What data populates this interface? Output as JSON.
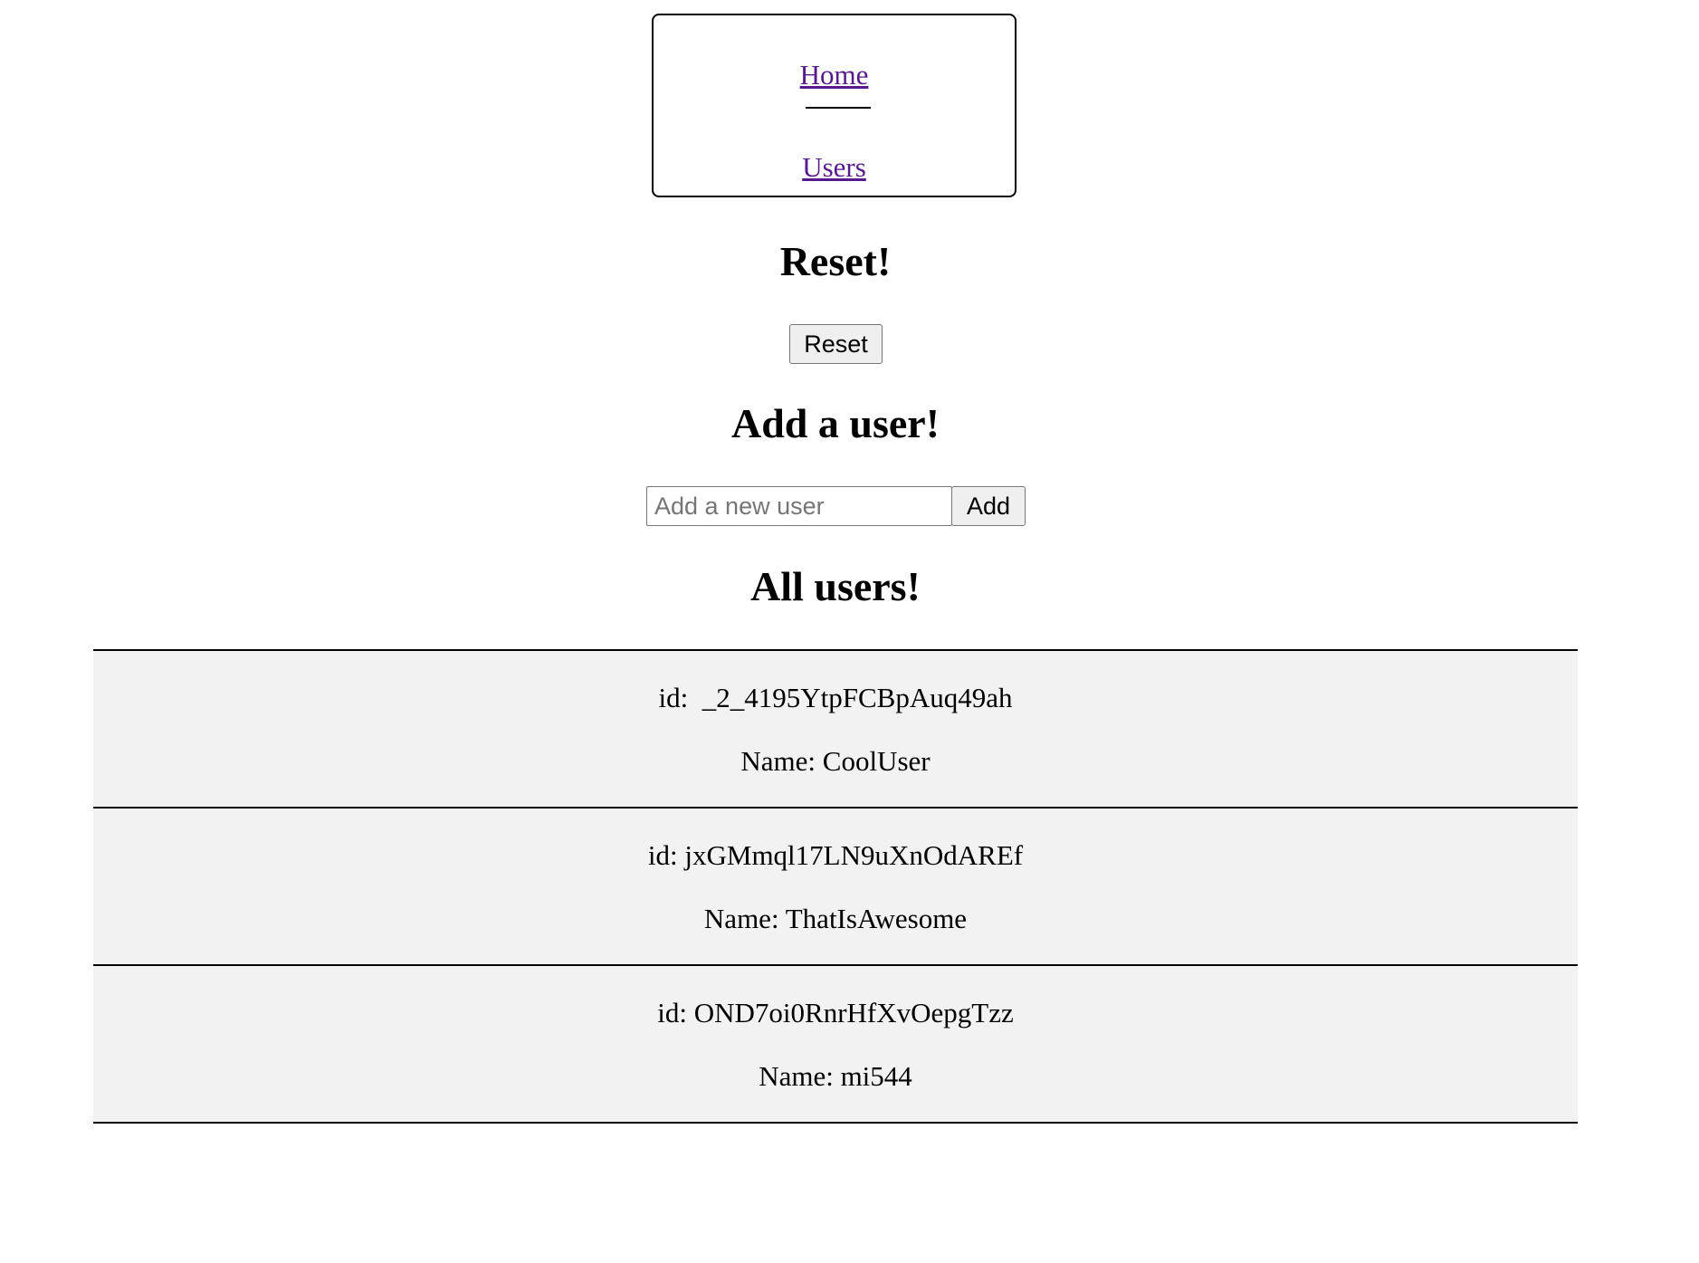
{
  "nav": {
    "home": "Home",
    "users": "Users"
  },
  "reset": {
    "heading": "Reset!",
    "button": "Reset"
  },
  "add_user": {
    "heading": "Add a user!",
    "placeholder": "Add a new user",
    "value": "",
    "button": "Add"
  },
  "users": {
    "heading": "All users!",
    "items": [
      {
        "id": "id:  _2_4195YtpFCBpAuq49ah",
        "name": "Name: CoolUser"
      },
      {
        "id": "id: jxGMmql17LN9uXnOdAREf",
        "name": "Name: ThatIsAwesome"
      },
      {
        "id": "id: OND7oi0RnrHfXvOepgTzz",
        "name": "Name: mi544"
      }
    ]
  }
}
